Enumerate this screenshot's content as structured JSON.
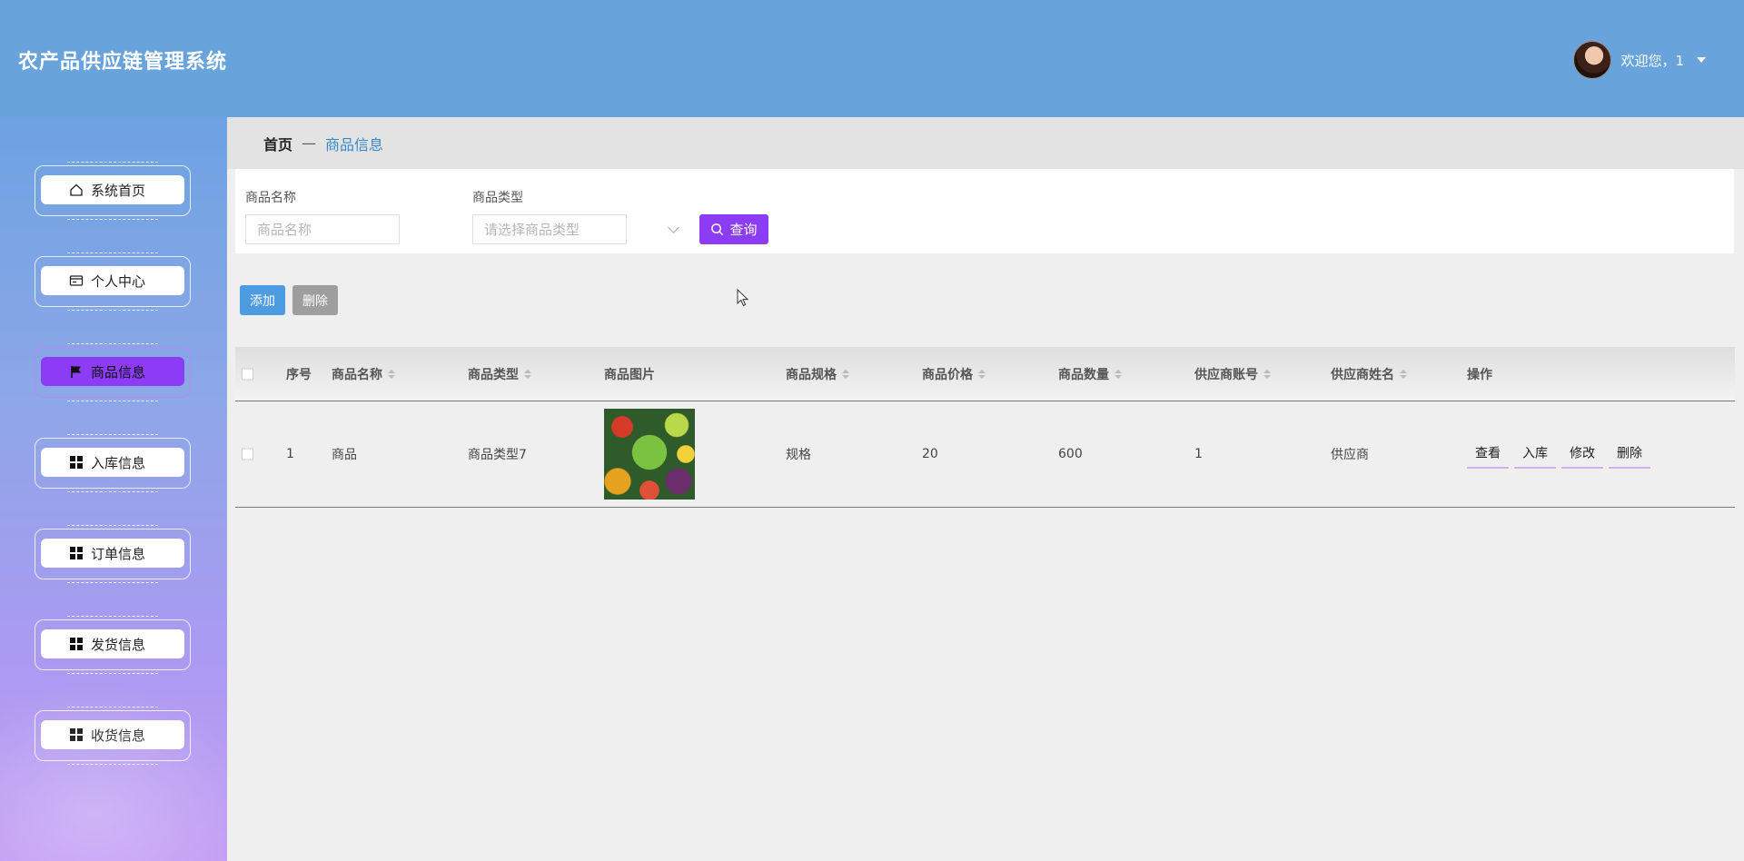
{
  "header": {
    "app_title": "农产品供应链管理系统",
    "welcome": "欢迎您，1"
  },
  "sidebar": {
    "items": [
      {
        "label": "系统首页",
        "icon": "home-icon"
      },
      {
        "label": "个人中心",
        "icon": "id-card-icon"
      },
      {
        "label": "商品信息",
        "icon": "flag-icon"
      },
      {
        "label": "入库信息",
        "icon": "grid-icon"
      },
      {
        "label": "订单信息",
        "icon": "grid-icon"
      },
      {
        "label": "发货信息",
        "icon": "grid-icon"
      },
      {
        "label": "收货信息",
        "icon": "grid-icon"
      }
    ],
    "active_index": 2
  },
  "breadcrumb": {
    "home": "首页",
    "separator": "—",
    "current": "商品信息"
  },
  "search": {
    "name_label": "商品名称",
    "name_placeholder": "商品名称",
    "type_label": "商品类型",
    "type_placeholder": "请选择商品类型",
    "query_label": "查询"
  },
  "actions": {
    "add_label": "添加",
    "delete_label": "删除"
  },
  "table": {
    "columns": [
      "序号",
      "商品名称",
      "商品类型",
      "商品图片",
      "商品规格",
      "商品价格",
      "商品数量",
      "供应商账号",
      "供应商姓名",
      "操作"
    ],
    "rows": [
      {
        "index": "1",
        "name": "商品",
        "type": "商品类型7",
        "spec": "规格",
        "price": "20",
        "quantity": "600",
        "supplier_account": "1",
        "supplier_name": "供应商"
      }
    ],
    "row_actions": [
      "查看",
      "入库",
      "修改",
      "删除"
    ]
  },
  "colors": {
    "header_bg": "#68a3dc",
    "accent": "#8b3cf4",
    "add_button": "#4d9be0",
    "delete_button": "#9e9e9e",
    "breadcrumb_link": "#3a87c8"
  }
}
